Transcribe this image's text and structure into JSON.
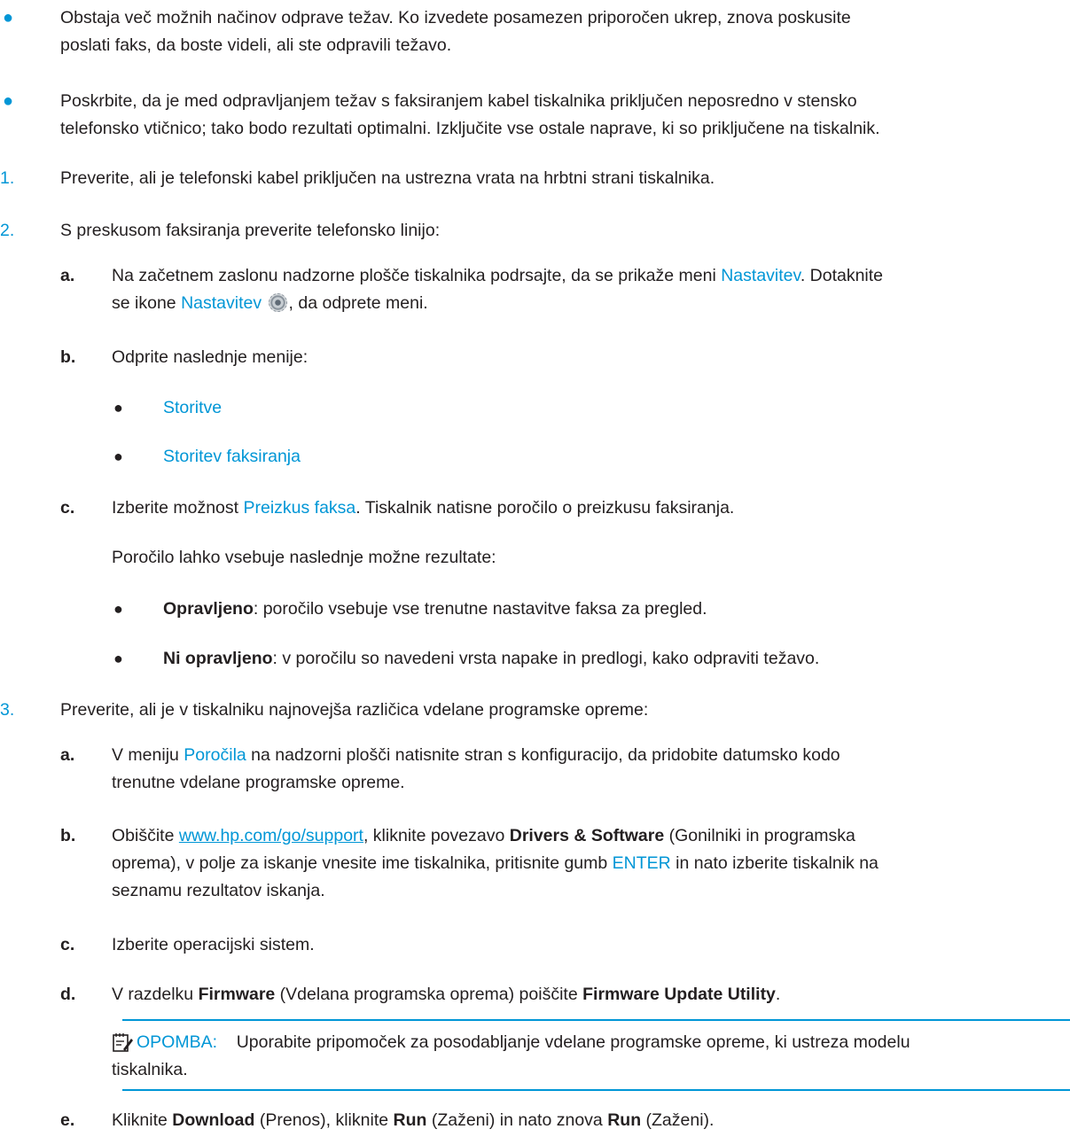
{
  "bullets": [
    {
      "l1": "Obstaja več možnih načinov odprave težav. Ko izvedete posamezen priporočen ukrep, znova poskusite",
      "l2": "poslati faks, da boste videli, ali ste odpravili težavo."
    },
    {
      "l1": "Poskrbite, da je med odpravljanjem težav s faksiranjem kabel tiskalnika priključen neposredno v stensko",
      "l2": "telefonsko vtičnico; tako bodo rezultati optimalni. Izključite vse ostale naprave, ki so priključene na tiskalnik."
    }
  ],
  "steps": {
    "s1": {
      "num": "1.",
      "text": "Preverite, ali je telefonski kabel priključen na ustrezna vrata na hrbtni strani tiskalnika."
    },
    "s2": {
      "num": "2.",
      "text": "S preskusom faksiranja preverite telefonsko linijo:",
      "a": {
        "letter": "a.",
        "l1_pre": "Na začetnem zaslonu nadzorne plošče tiskalnika podrsajte, da se prikaže meni ",
        "l1_link": "Nastavitev",
        "l1_post": ". Dotaknite",
        "l2_pre": "se ikone ",
        "l2_link": "Nastavitev",
        "l2_post": ", da odprete meni.",
        "icon": "settings-gear-icon"
      },
      "b": {
        "letter": "b.",
        "text": "Odprite naslednje menije:",
        "items": [
          "Storitve",
          "Storitev faksiranja"
        ]
      },
      "c": {
        "letter": "c.",
        "pre": "Izberite možnost ",
        "link": "Preizkus faksa",
        "post": ". Tiskalnik natisne poročilo o preizkusu faksiranja.",
        "para": "Poročilo lahko vsebuje naslednje možne rezultate:",
        "r1_bold": "Opravljeno",
        "r1_text": ": poročilo vsebuje vse trenutne nastavitve faksa za pregled.",
        "r2_bold": "Ni opravljeno",
        "r2_text": ": v poročilu so navedeni vrsta napake in predlogi, kako odpraviti težavo."
      }
    },
    "s3": {
      "num": "3.",
      "text": "Preverite, ali je v tiskalniku najnovejša različica vdelane programske opreme:",
      "a": {
        "letter": "a.",
        "pre": "V meniju ",
        "link": "Poročila",
        "post": " na nadzorni plošči natisnite stran s konfiguracijo, da pridobite datumsko kodo",
        "l2": "trenutne vdelane programske opreme."
      },
      "b": {
        "letter": "b.",
        "pre": "Obiščite ",
        "url": "www.hp.com/go/support",
        "mid": ", kliknite povezavo ",
        "bold": "Drivers & Software",
        "post": " (Gonilniki in programska",
        "l2_pre": "oprema), v polje za iskanje vnesite ime tiskalnika, pritisnite gumb ",
        "l2_link": "ENTER",
        "l2_post": " in nato izberite tiskalnik na",
        "l3": "seznamu rezultatov iskanja."
      },
      "c": {
        "letter": "c.",
        "text": "Izberite operacijski sistem."
      },
      "d": {
        "letter": "d.",
        "pre": "V razdelku ",
        "bold1": "Firmware",
        "mid": " (Vdelana programska oprema) poiščite ",
        "bold2": "Firmware Update Utility",
        "post": "."
      },
      "note": {
        "label": "OPOMBA:",
        "l1": "Uporabite pripomoček za posodabljanje vdelane programske opreme, ki ustreza modelu",
        "l2": "tiskalnika.",
        "icon": "note-icon"
      },
      "e": {
        "letter": "e.",
        "pre": "Kliknite ",
        "bold1": "Download",
        "t1": " (Prenos), kliknite ",
        "bold2": "Run",
        "t2": " (Zaženi) in nato znova ",
        "bold3": "Run",
        "t3": " (Zaženi)."
      }
    }
  },
  "colors": {
    "accent": "#0096d6",
    "text": "#231f20"
  }
}
